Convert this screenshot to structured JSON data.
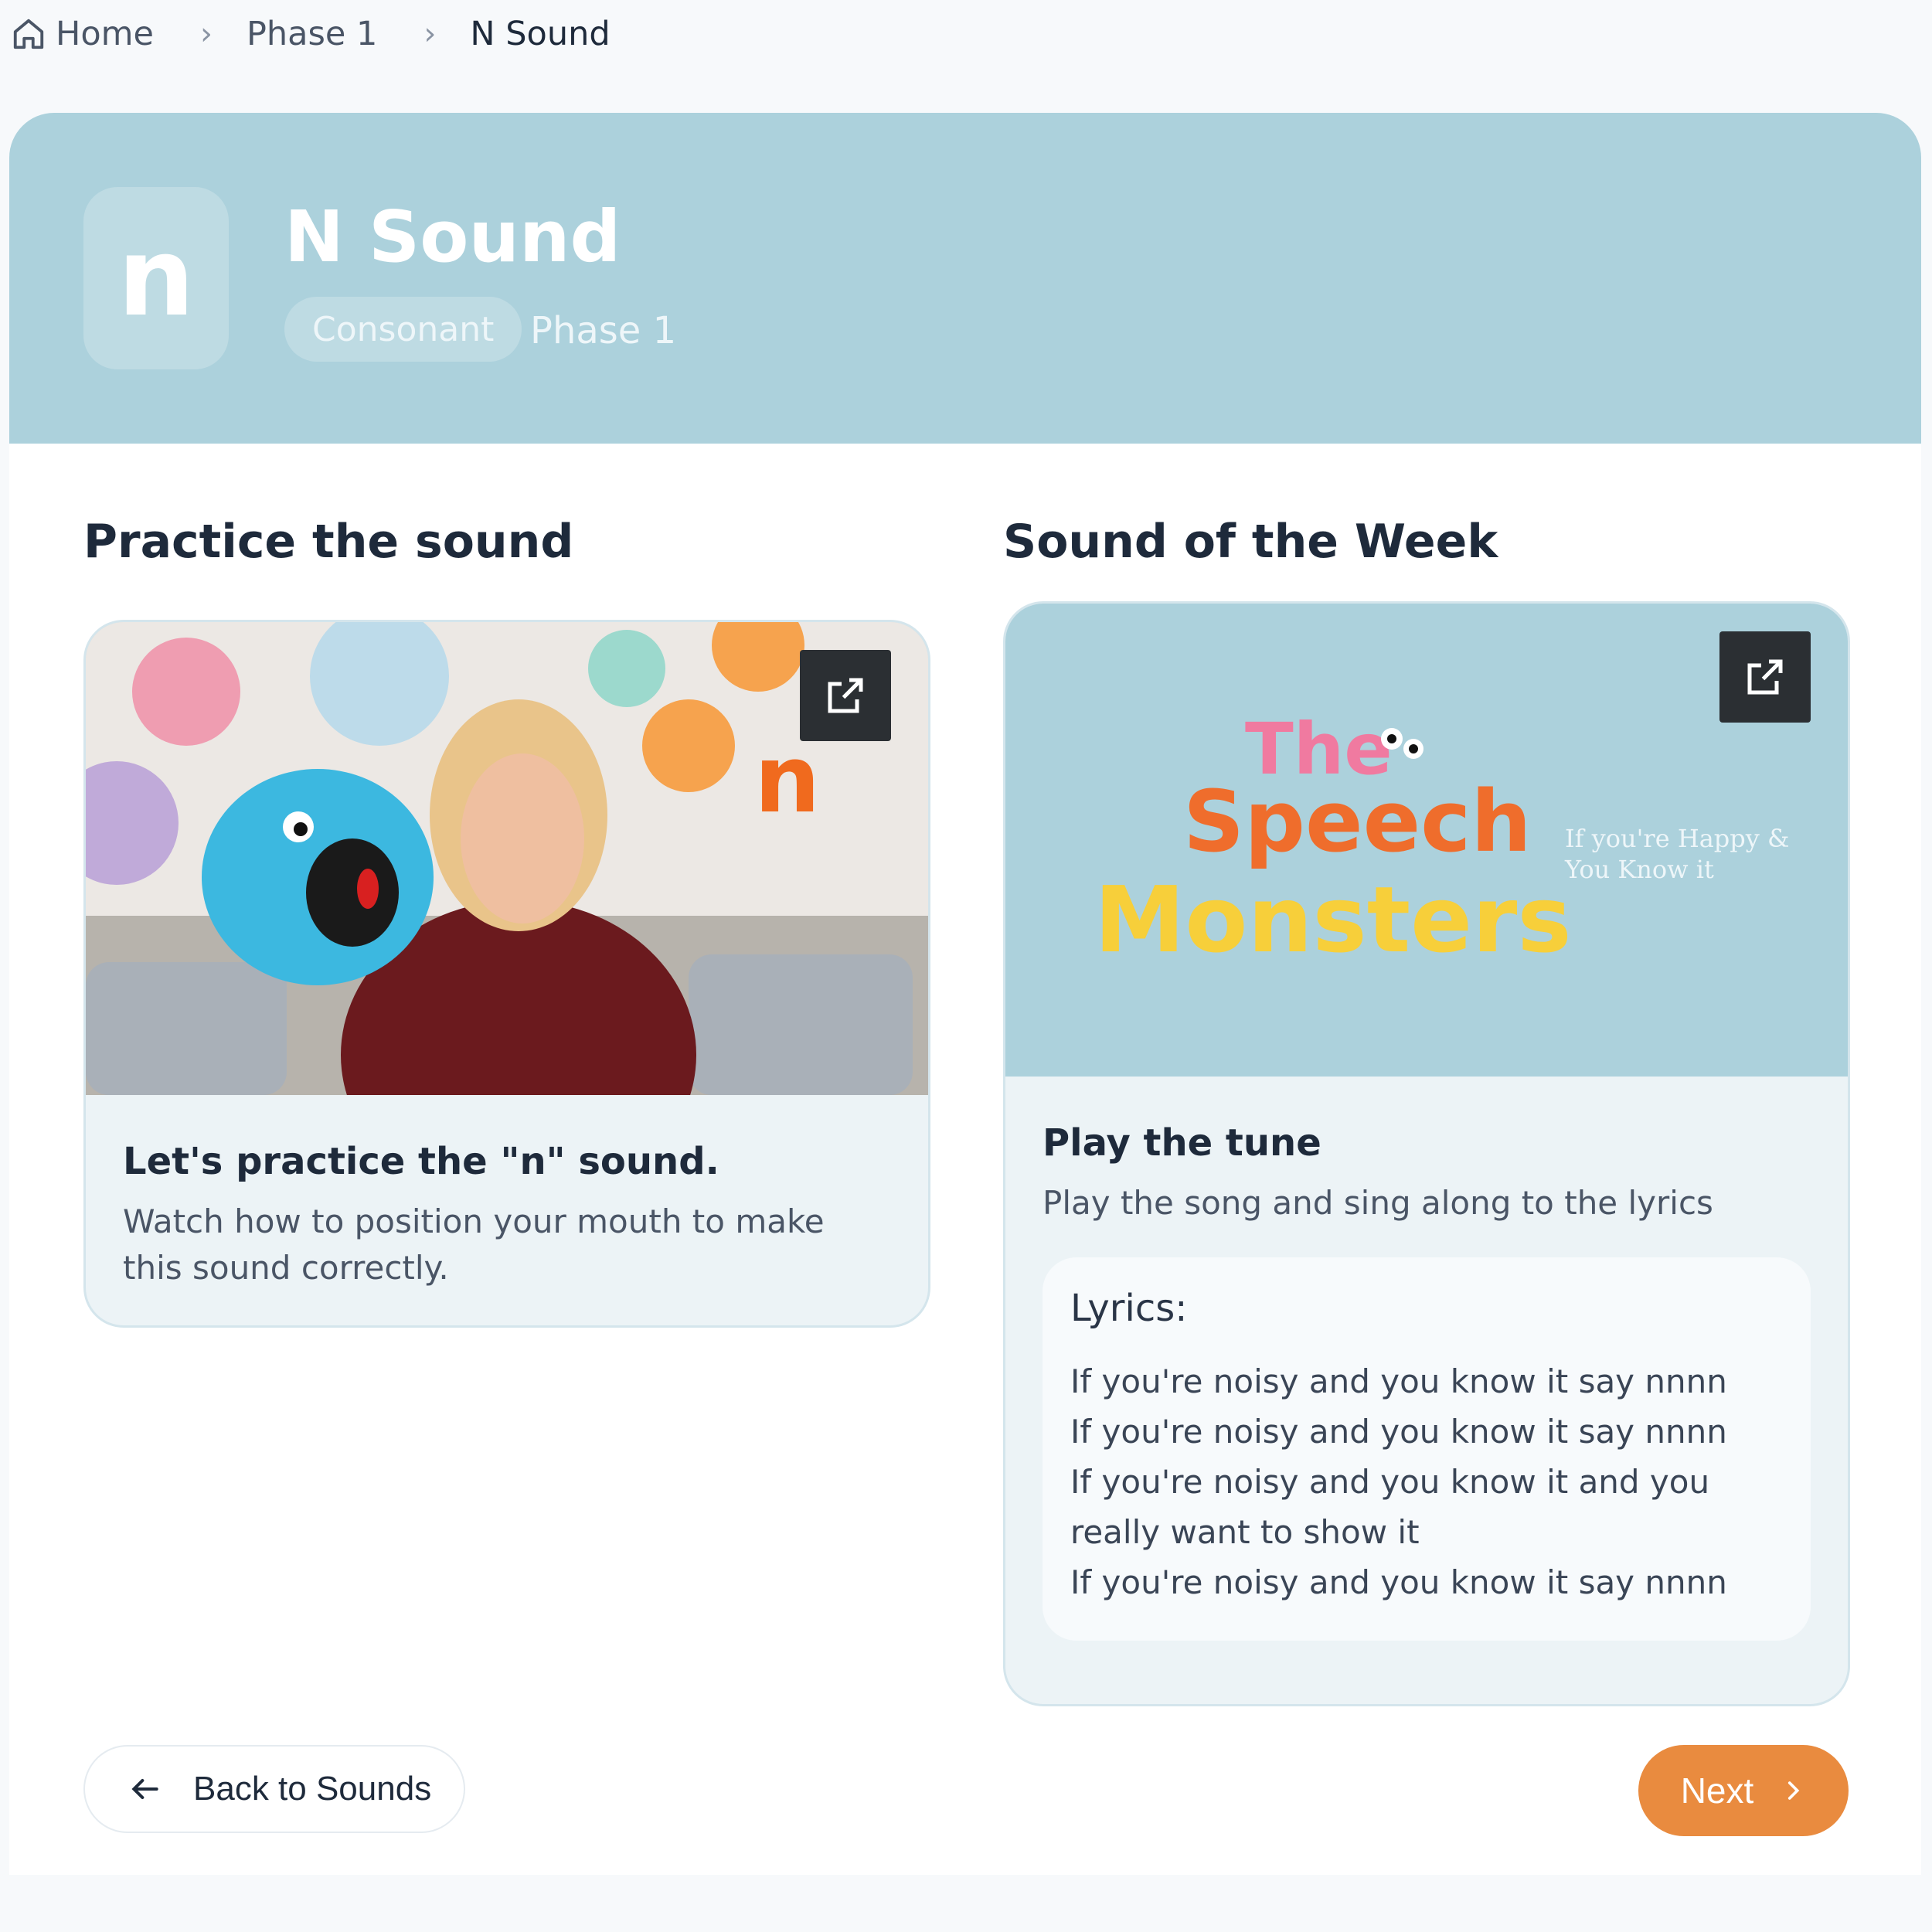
{
  "breadcrumb": {
    "home": "Home",
    "phase": "Phase 1",
    "current": "N Sound"
  },
  "hero": {
    "letter": "n",
    "title": "N Sound",
    "type_badge": "Consonant",
    "phase": "Phase 1",
    "color": "#acd1dc"
  },
  "practice": {
    "section_title": "Practice the sound",
    "video_overlay_letter": "n",
    "heading": "Let's practice the \"n\" sound.",
    "description": "Watch how to position your mouth to make this sound correctly."
  },
  "week": {
    "section_title": "Sound of the Week",
    "logo_line1": "The",
    "logo_line2": "Speech",
    "logo_line3": "Monsters",
    "song_title_line1": "If you're Happy &",
    "song_title_line2": "You Know it",
    "heading": "Play the tune",
    "description": "Play the song and sing along to the lyrics",
    "lyrics_title": "Lyrics:",
    "lyrics": [
      "If you're noisy and you know it say nnnn",
      "If you're noisy and you know it say nnnn",
      "If you're noisy and you know it and you really want to show it",
      "If you're noisy and you know it say nnnn"
    ]
  },
  "footer": {
    "back_label": "Back to Sounds",
    "next_label": "Next",
    "accent": "#e98b3f"
  },
  "icons": {
    "home": "home-icon",
    "chevron": "chevron-right-icon",
    "open": "external-link-icon",
    "back": "arrow-left-icon"
  }
}
